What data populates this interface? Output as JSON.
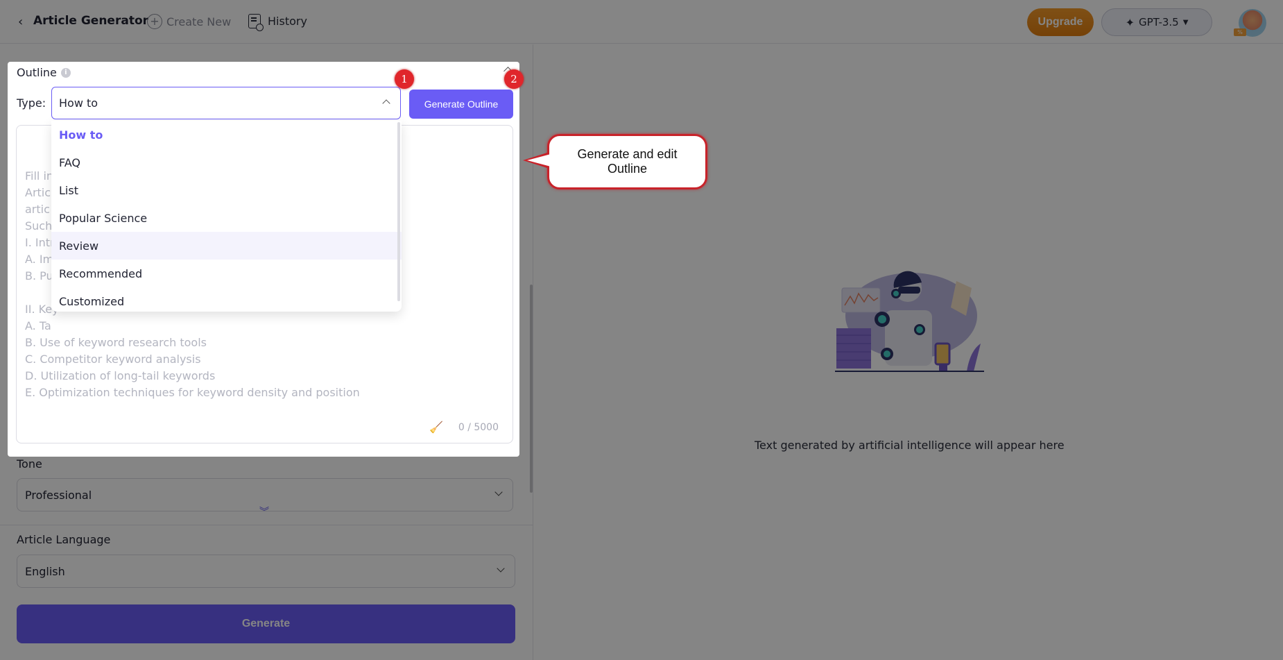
{
  "topbar": {
    "title": "Article Generator",
    "create_new_label": "Create New",
    "history_label": "History",
    "upgrade_label": "Upgrade",
    "model_label": "GPT-3.5",
    "avatar_badge": "%"
  },
  "outline": {
    "section_title": "Outline",
    "info_icon": "i",
    "type_label": "Type:",
    "type_value": "How to",
    "generate_outline_label": "Generate Outline",
    "placeholder_lines": [
      "Fill in",
      "Artic                                                                    n of the generated",
      "artic",
      "Such",
      "I. Intr",
      "A. Im",
      "B. Pu",
      "",
      "II. Key",
      "A. Ta",
      "B. Use of keyword research tools",
      "C. Competitor keyword analysis",
      "D. Utilization of long-tail keywords",
      "E. Optimization techniques for keyword density and position"
    ],
    "counter": "0 / 5000",
    "type_options": [
      {
        "label": "How to",
        "state": "selected"
      },
      {
        "label": "FAQ",
        "state": ""
      },
      {
        "label": "List",
        "state": ""
      },
      {
        "label": "Popular Science",
        "state": ""
      },
      {
        "label": "Review",
        "state": "hover"
      },
      {
        "label": "Recommended",
        "state": ""
      },
      {
        "label": "Customized",
        "state": ""
      }
    ]
  },
  "tone": {
    "label": "Tone",
    "value": "Professional"
  },
  "language": {
    "label": "Article Language",
    "value": "English"
  },
  "generate_label": "Generate",
  "output": {
    "empty_text": "Text generated by artificial intelligence will appear here"
  },
  "annotations": {
    "marker_1": "1",
    "marker_2": "2",
    "callout_text": "Generate and edit Outline"
  },
  "colors": {
    "accent": "#6a5cf5",
    "upgrade": "#e88a1a",
    "marker": "#e0262b"
  }
}
